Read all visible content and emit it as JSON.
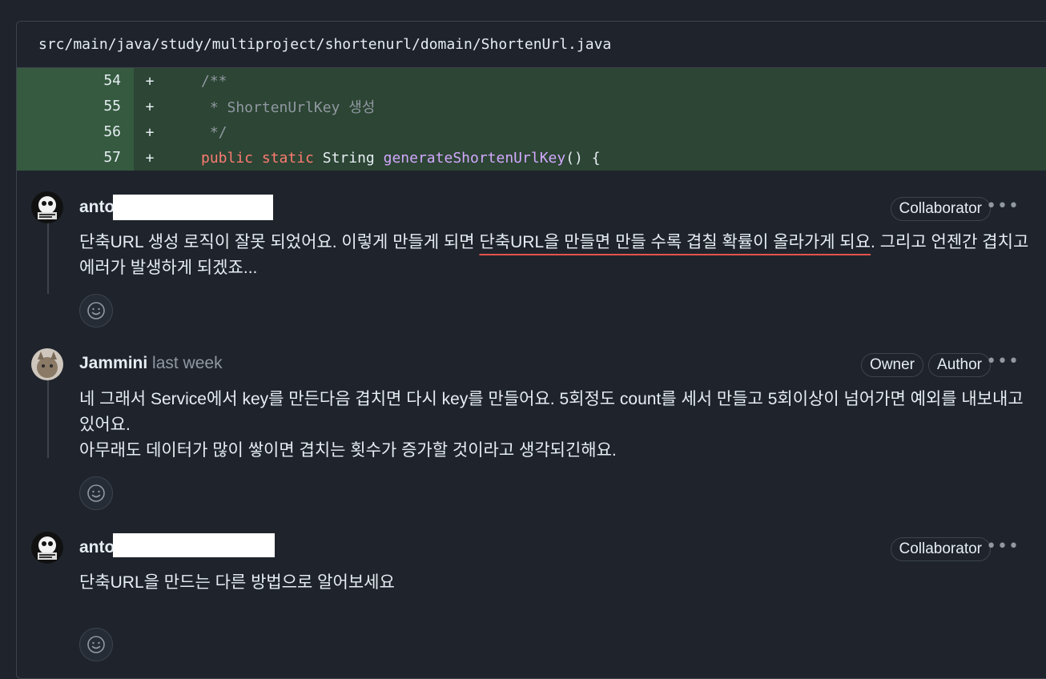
{
  "file": {
    "path": "src/main/java/study/multiproject/shortenurl/domain/ShortenUrl.java"
  },
  "diff": {
    "lines": [
      {
        "number": "54",
        "sign": "+",
        "code": "/**"
      },
      {
        "number": "55",
        "sign": "+",
        "code": " * ShortenUrlKey 생성"
      },
      {
        "number": "56",
        "sign": "+",
        "code": " */"
      },
      {
        "number": "57",
        "sign": "+",
        "kw1": "public",
        "kw2": "static",
        "type": "String",
        "fn": "generateShortenUrlKey",
        "rest": "() {"
      }
    ]
  },
  "comments": [
    {
      "author": "anto",
      "badges": [
        "Collaborator"
      ],
      "text_before": "단축URL 생성 로직이 잘못 되었어요. 이렇게 만들게 되면 ",
      "text_underlined": "단축URL을 만들면 만들 수록 겹칠 확률이 올라가게 되요",
      "text_after": ". 그리고 언젠간 겹치고 에러가 발생하게 되겠죠..."
    },
    {
      "author": "Jammini",
      "time": "last week",
      "badges": [
        "Owner",
        "Author"
      ],
      "line1": "네 그래서 Service에서 key를 만든다음 겹치면 다시 key를 만들어요. 5회정도 count를 세서 만들고 5회이상이 넘어가면 예외를 내보내고 있어요.",
      "line2": "아무래도 데이터가 많이 쌓이면 겹치는 횟수가 증가할 것이라고 생각되긴해요."
    },
    {
      "author": "anto",
      "badges": [
        "Collaborator"
      ],
      "text": "단축URL을 만드는 다른 방법으로 알어보세요"
    }
  ],
  "icons": {
    "more": "kebab-horizontal-icon",
    "reaction": "smiley-icon"
  },
  "colors": {
    "added_bg": "#2c4534",
    "keyword": "#ff7b72",
    "function": "#d2a8ff",
    "underline": "#e5534b"
  }
}
